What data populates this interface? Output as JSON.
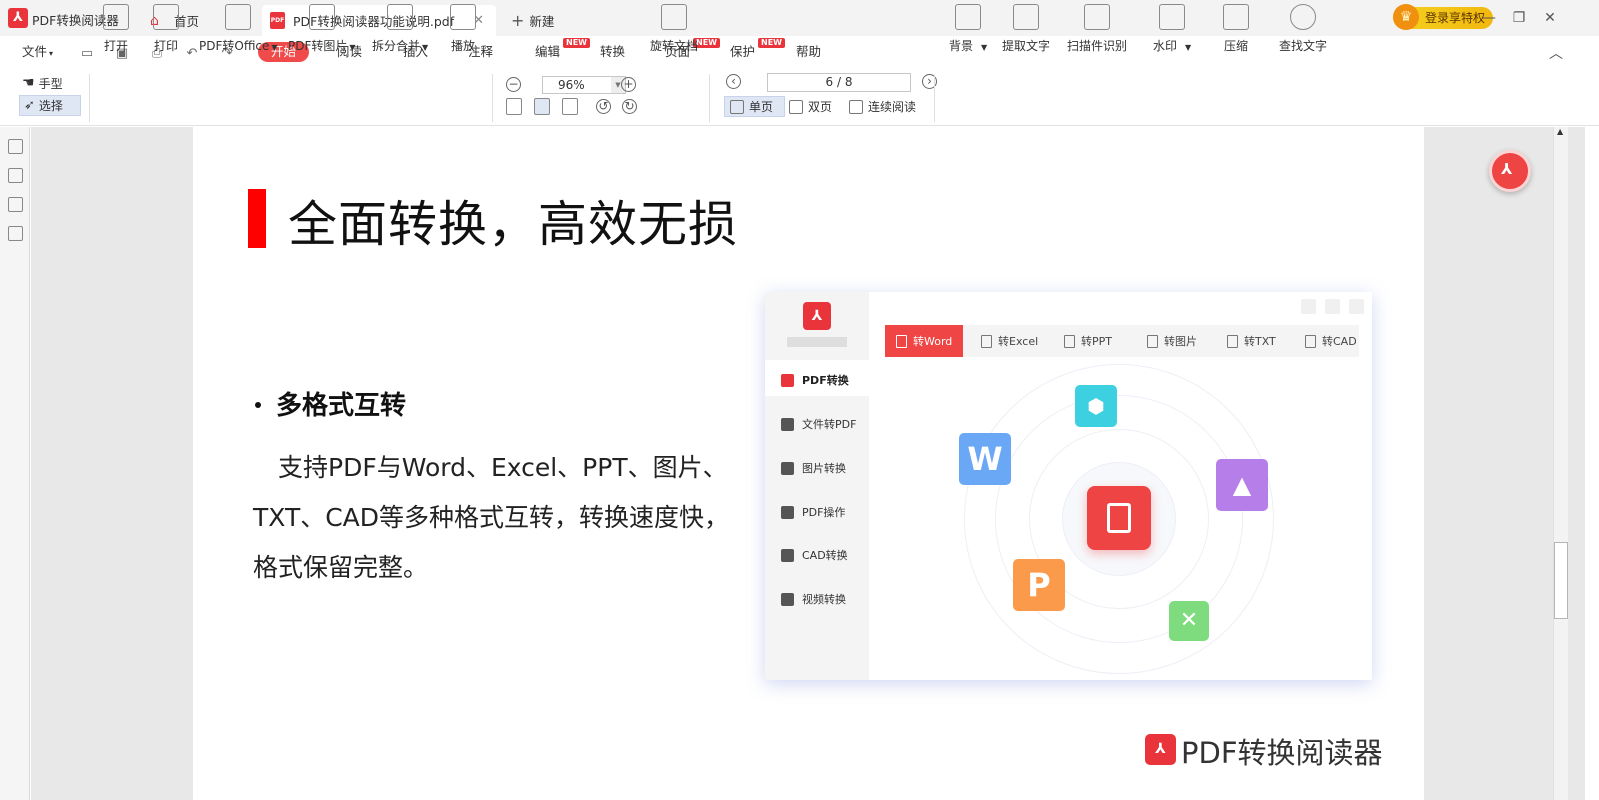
{
  "titlebar": {
    "app_name": "PDF转换阅读器",
    "tabs": [
      {
        "label": "首页"
      },
      {
        "label": "PDF转换阅读器功能说明.pdf"
      },
      {
        "label": "新建"
      }
    ],
    "vip_label": "登录享特权"
  },
  "menu": {
    "items": [
      "文件",
      "开始",
      "阅读",
      "插入",
      "注释",
      "编辑",
      "转换",
      "页面",
      "保护",
      "帮助"
    ],
    "badge": "NEW"
  },
  "ribbon": {
    "hand": "手型",
    "select": "选择",
    "open": "打开",
    "print": "打印",
    "pdf_to_office": "PDF转Office",
    "pdf_to_image": "PDF转图片",
    "split_merge": "拆分合并",
    "play": "播放",
    "zoom": "96%",
    "rotate": "旋转文档",
    "page_nav": "6 / 8",
    "single": "单页",
    "double": "双页",
    "continuous": "连续阅读",
    "background": "背景",
    "extract_text": "提取文字",
    "scan_ocr": "扫描件识别",
    "watermark": "水印",
    "compress": "压缩",
    "find_text": "查找文字"
  },
  "doc": {
    "title": "全面转换，高效无损",
    "bullet_title": "多格式互转",
    "body": "支持PDF与Word、Excel、PPT、图片、TXT、CAD等多种格式互转，转换速度快，格式保留完整。",
    "footer_brand": "PDF转换阅读器"
  },
  "mock": {
    "sidebar": [
      "PDF转换",
      "文件转PDF",
      "图片转换",
      "PDF操作",
      "CAD转换",
      "视频转换"
    ],
    "tabs": [
      "转Word",
      "转Excel",
      "转PPT",
      "转图片",
      "转TXT",
      "转CAD"
    ],
    "tiles": {
      "word": "W",
      "ppt": "P",
      "excel": "✕"
    }
  },
  "colors": {
    "brand_red": "#e8343a",
    "tab_active": "#f04545",
    "accent_yellow": "#f6d21f"
  }
}
